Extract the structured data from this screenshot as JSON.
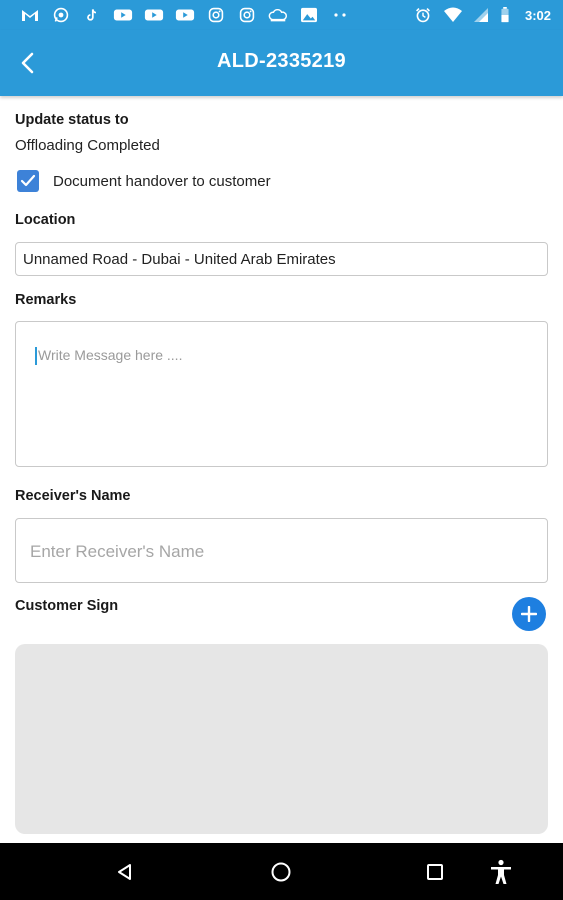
{
  "status_bar": {
    "time": "3:02",
    "left_icons": [
      "gmail-icon",
      "whatsapp-icon",
      "tiktok-icon",
      "youtube-icon",
      "youtube-icon",
      "youtube-icon",
      "instagram-icon",
      "instagram-icon",
      "cloud-icon",
      "image-icon",
      "more-dots-icon"
    ],
    "right_icons": [
      "alarm-icon",
      "wifi-icon",
      "signal-icon",
      "battery-icon"
    ]
  },
  "app_bar": {
    "title": "ALD-2335219",
    "back_icon": "chevron-left-icon"
  },
  "form": {
    "status_label": "Update status to",
    "status_value": "Offloading Completed",
    "checkbox_label": "Document handover to customer",
    "checkbox_checked": true,
    "location_label": "Location",
    "location_value": "Unnamed Road - Dubai - United Arab Emirates",
    "remarks_label": "Remarks",
    "remarks_placeholder": "Write Message here ....",
    "receiver_label": "Receiver's Name",
    "receiver_placeholder": "Enter Receiver's Name",
    "sign_label": "Customer Sign"
  },
  "nav_bar": {
    "icons": [
      "back-triangle-icon",
      "home-circle-icon",
      "recents-square-icon",
      "accessibility-icon"
    ]
  },
  "colors": {
    "primary": "#2b9ad8",
    "add_button": "#1e7fe0",
    "checkbox": "#3d82d8",
    "sign_area": "#e6e6e6"
  }
}
